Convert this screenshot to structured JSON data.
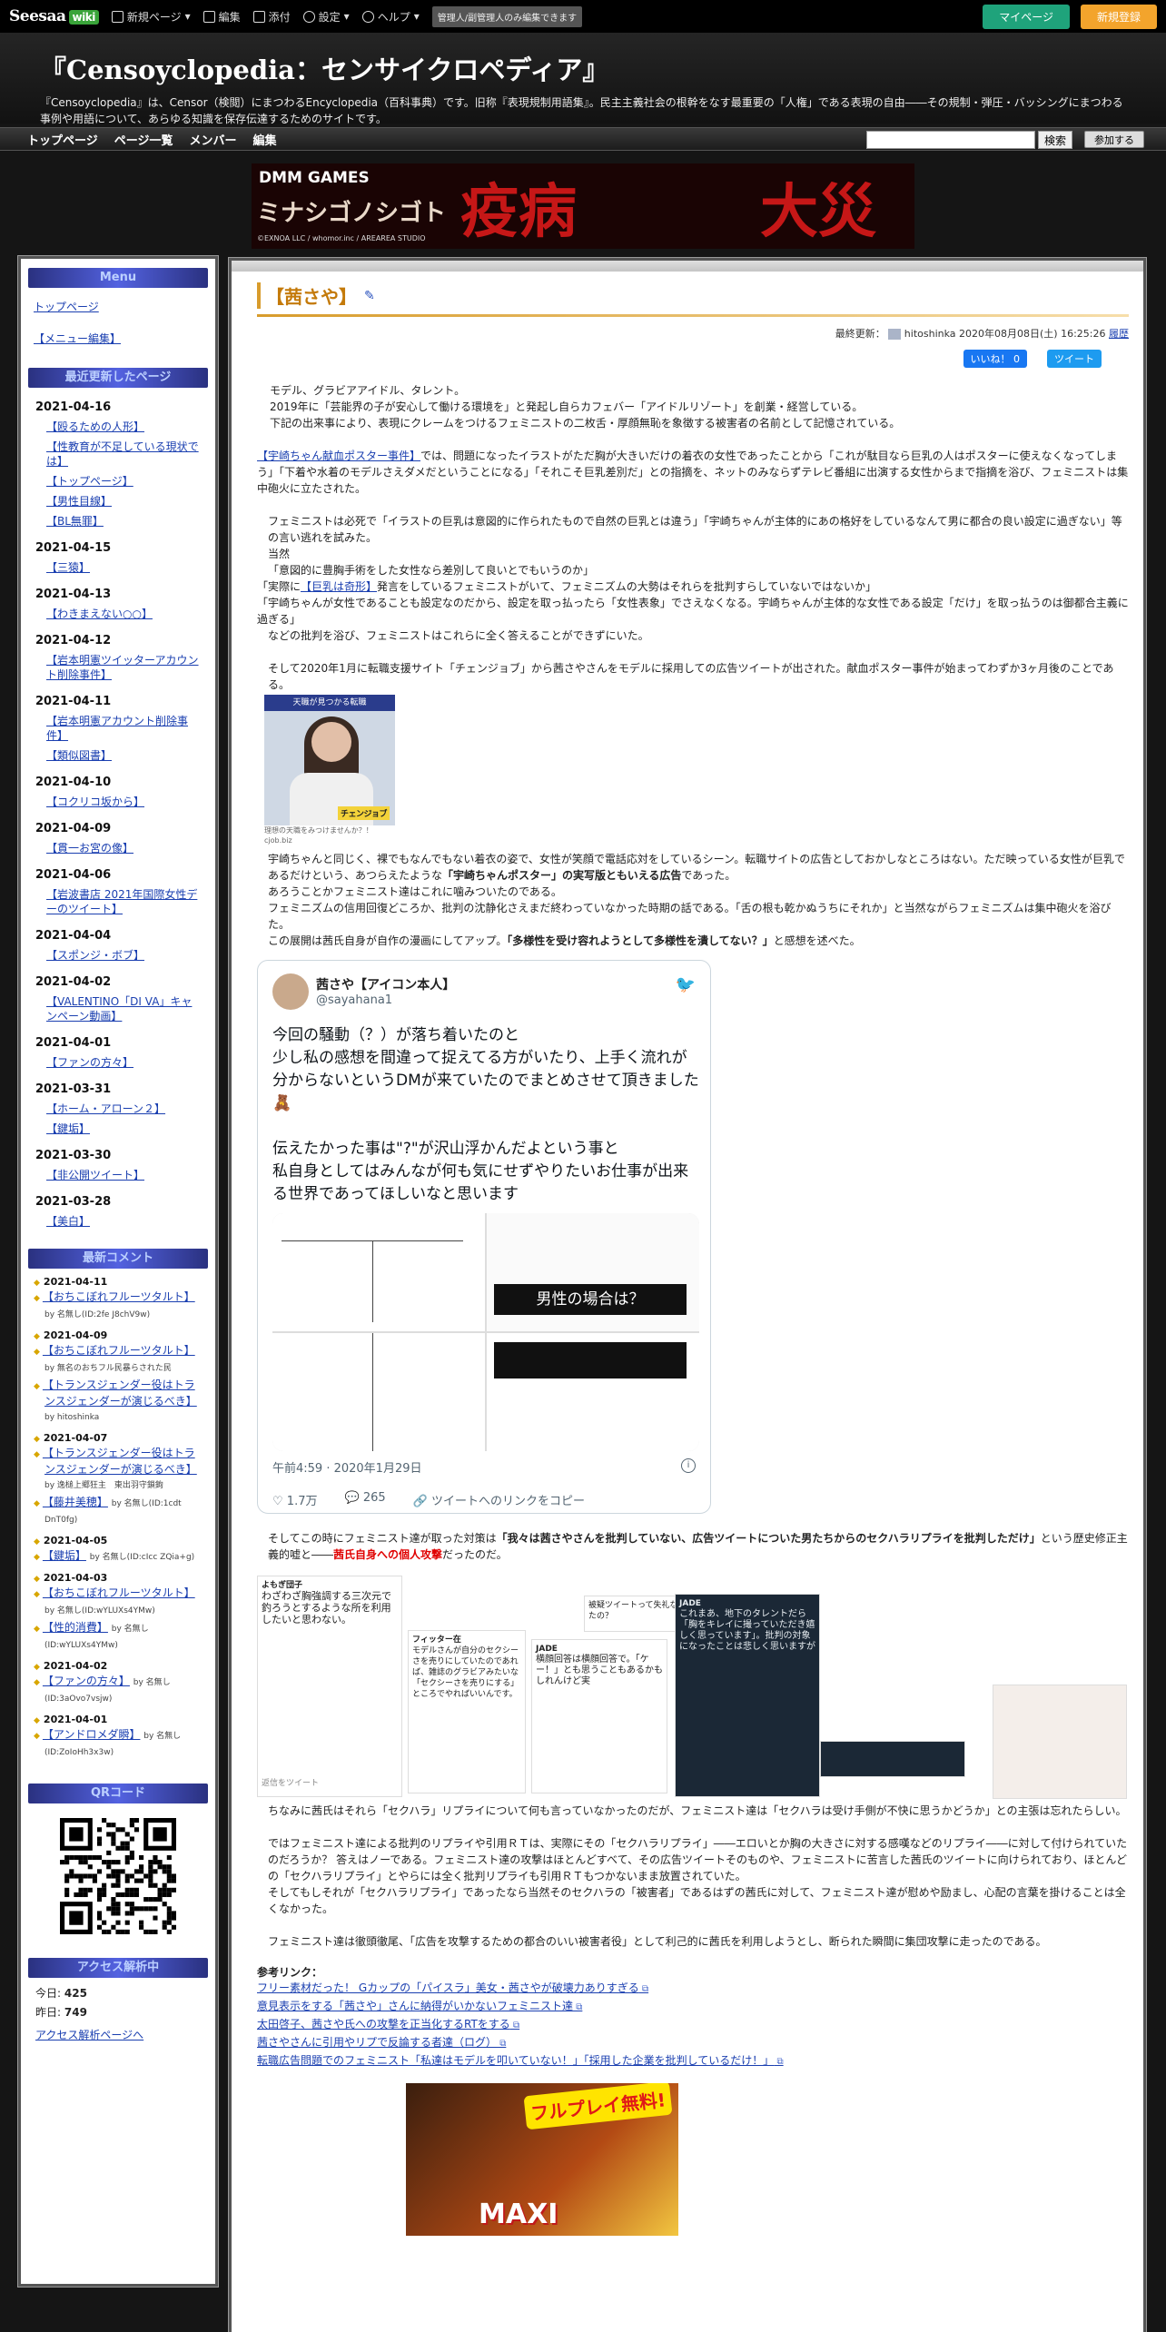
{
  "topbar": {
    "logo": "Seesaa",
    "logo_wiki": "wiki",
    "items": [
      "新規ページ",
      "編集",
      "添付",
      "設定",
      "ヘルプ"
    ],
    "admin_note": "管理人/副管理人のみ編集できます",
    "mypage": "マイページ",
    "join": "新規登録"
  },
  "header": {
    "title": "『Censoyclopedia：センサイクロペディア』",
    "desc_line1": "『Censoyclopedia』は、Censor（検閲）にまつわるEncyclopedia（百科事典）です。旧称『表現規制用語集』。民主主義社会の根幹をなす最重要の「人権」である表現の自由――その規制・弾圧・バッシングにまつわる事例や用語について、あらゆる知識を保存伝達するためのサイトです。"
  },
  "nav": {
    "items": [
      "トップページ",
      "ページ一覧",
      "メンバー",
      "編集"
    ],
    "search_button": "検索",
    "join_button": "参加する"
  },
  "banner": {
    "brand": "DMM GAMES",
    "game_title": "ミナシゴノシゴト",
    "copyright": "©EXNOA LLC / whomor.inc / AREAREA STUDIO",
    "kanji_left": "疫病",
    "kanji_right": "大災害"
  },
  "sidebar": {
    "menu_head": "Menu",
    "menu_links": [
      "トップページ",
      "【メニュー編集】"
    ],
    "recent_head": "最近更新したページ",
    "recent": [
      {
        "date": "2021-04-16",
        "items": [
          "【殴るための人形】",
          "【性教育が不足している現状では】",
          "【トップページ】",
          "【男性目線】",
          "【BL無罪】"
        ]
      },
      {
        "date": "2021-04-15",
        "items": [
          "【三猿】"
        ]
      },
      {
        "date": "2021-04-13",
        "items": [
          "【わきまえない○○】"
        ]
      },
      {
        "date": "2021-04-12",
        "items": [
          "【岩本明憲ツイッターアカウント削除事件】"
        ]
      },
      {
        "date": "2021-04-11",
        "items": [
          "【岩本明憲アカウント削除事件】",
          "【類似図書】"
        ]
      },
      {
        "date": "2021-04-10",
        "items": [
          "【コクリコ坂から】"
        ]
      },
      {
        "date": "2021-04-09",
        "items": [
          "【貫一お宮の像】"
        ]
      },
      {
        "date": "2021-04-06",
        "items": [
          "【岩波書店 2021年国際女性デーのツイート】"
        ]
      },
      {
        "date": "2021-04-04",
        "items": [
          "【スポンジ・ボブ】"
        ]
      },
      {
        "date": "2021-04-02",
        "items": [
          "【VALENTINO「DI VA」キャンペーン動画】"
        ]
      },
      {
        "date": "2021-04-01",
        "items": [
          "【ファンの方々】"
        ]
      },
      {
        "date": "2021-03-31",
        "items": [
          "【ホーム・アローン２】",
          "【鍵垢】"
        ]
      },
      {
        "date": "2021-03-30",
        "items": [
          "【非公開ツイート】"
        ]
      },
      {
        "date": "2021-03-28",
        "items": [
          "【美白】"
        ]
      }
    ],
    "comments_head": "最新コメント",
    "comments": [
      {
        "date": "2021-04-11",
        "items": [
          {
            "link": "【おちこぼれフルーツタルト】",
            "by": "by 名無し(ID:2fe J8chV9w)"
          }
        ]
      },
      {
        "date": "2021-04-09",
        "items": [
          {
            "link": "【おちこぼれフルーツタルト】",
            "by": "by 無名のおちフル民暴らされた民"
          },
          {
            "link": "【トランスジェンダー役はトランスジェンダーが演じるべき】",
            "by": "by hitoshinka"
          }
        ]
      },
      {
        "date": "2021-04-07",
        "items": [
          {
            "link": "【トランスジェンダー役はトランスジェンダーが演じるべき】",
            "by": "by 逸槌上郷狂主　東出羽守鎖鉤"
          },
          {
            "link": "【藤井美穂】",
            "by": "by 名無し(ID:1cdt DnT0fg)"
          }
        ]
      },
      {
        "date": "2021-04-05",
        "items": [
          {
            "link": "【鍵垢】",
            "by": "by 名無し(ID:cIcc ZQia+g)"
          }
        ]
      },
      {
        "date": "2021-04-03",
        "items": [
          {
            "link": "【おちこぼれフルーツタルト】",
            "by": "by 名無し(ID:wYLUXs4YMw)"
          },
          {
            "link": "【性的消費】",
            "by": "by 名無し(ID:wYLUXs4YMw)"
          }
        ]
      },
      {
        "date": "2021-04-02",
        "items": [
          {
            "link": "【ファンの方々】",
            "by": "by 名無し(ID:3aOvo7vsjw)"
          }
        ]
      },
      {
        "date": "2021-04-01",
        "items": [
          {
            "link": "【アンドロメダ瞬】",
            "by": "by 名無し(ID:ZoIoHh3x3w)"
          }
        ]
      }
    ],
    "qr_head": "QRコード",
    "access_head": "アクセス解析中",
    "today_label": "今日:",
    "today_value": "425",
    "yesterday_label": "昨日:",
    "yesterday_value": "749",
    "access_link": "アクセス解析ページへ"
  },
  "main": {
    "title": "【茜さや】",
    "updated_label": "最終更新：",
    "updated_user": "hitoshinka",
    "updated_date": "2020年08月08日(土) 16:25:26",
    "history": "履歴",
    "fb_like": "いいね！ 0",
    "tw_tweet": "ツイート",
    "intro": [
      "モデル、グラビアアイドル、タレント。",
      "2019年に「芸能界の子が安心して働ける環境を」と発起し自らカフェバー「アイドルリゾート」を創業・経営している。",
      "下記の出来事により、表現にクレームをつけるフェミニストの二枚舌・厚顔無恥を象徴する被害者の名前として記憶されている。"
    ],
    "p2_link": "【宇崎ちゃん献血ポスター事件】",
    "p2_text": "では、問題になったイラストがただ胸が大きいだけの着衣の女性であったことから「これが駄目なら巨乳の人はポスターに使えなくなってしまう」「下着や水着のモデルさえダメだということになる」「それこそ巨乳差別だ」との指摘を、ネットのみならずテレビ番組に出演する女性からまで指摘を浴び、フェミニストは集中砲火に立たされた。",
    "p3": [
      "フェミニストは必死で「イラストの巨乳は意図的に作られたもので自然の巨乳とは違う」「宇崎ちゃんが主体的にあの格好をしているなんて男に都合の良い設定に過ぎない」等の言い逃れを試みた。",
      "当然",
      "「意図的に豊胸手術をした女性なら差別して良いとでもいうのか」"
    ],
    "p3_pre": "「実際に",
    "p3_link": "【巨乳は奇形】",
    "p3_post": "発言をしているフェミニストがいて、フェミニズムの大勢はそれらを批判すらしていないではないか」",
    "p3b": [
      "「宇崎ちゃんが女性であることも設定なのだから、設定を取っ払ったら「女性表象」でさえなくなる。宇崎ちゃんが主体的な女性である設定「だけ」を取っ払うのは御都合主義に過ぎる」",
      "などの批判を浴び、フェミニストはこれらに全く答えることができずにいた。"
    ],
    "p4": "そして2020年1月に転職支援サイト「チェンジョブ」から茜さやさんをモデルに採用しての広告ツイートが出された。献血ポスター事件が始まってわずか3ヶ月後のことである。",
    "ad_bar": "天職が見つかる転職",
    "ad_logo": "チェンジョブ",
    "ad_cap1": "理想の天職をみつけませんか？！",
    "ad_cap2": "cjob.biz",
    "p5_1": "宇崎ちゃんと同じく、裸でもなんでもない着衣の姿で、女性が笑顔で電話応対をしているシーン。転職サイトの広告としておかしなところはない。ただ映っている女性が巨乳であるだけという、あつらえたような",
    "p5_1b": "「宇崎ちゃんポスター」の実写版ともいえる広告",
    "p5_1c": "であった。",
    "p5_2": "あろうことかフェミニスト達はこれに噛みついたのである。",
    "p5_3": "フェミニズムの信用回復どころか、批判の沈静化さえまだ終わっていなかった時期の話である。「舌の根も乾かぬうちにそれか」と当然ながらフェミニズムは集中砲火を浴びた。",
    "p5_4a": "この展開は茜氏自身が自作の漫画にしてアップ。",
    "p5_4b": "「多様性を受け容れようとして多様性を潰してない？」",
    "p5_4c": "と感想を述べた。",
    "tweet": {
      "name": "茜さや【アイコン本人】",
      "handle": "@sayahana1",
      "text": "今回の騒動（？）が落ち着いたのと\n少し私の感想を間違って捉えてる方がいたり、上手く流れが分からないというDMが来ていたのでまとめさせて頂きました🧸\n\n伝えたかった事は\"?\"が沢山浮かんだよという事と\n私自身としてはみんなが何も気にせずやりたいお仕事が出来る世界であってほしいなと思います",
      "manga_caption": "男性の場合は？",
      "time": "午前4:59 · 2020年1月29日",
      "likes": "1.7万",
      "replies": "265",
      "copy_link": "ツイートへのリンクをコピー"
    },
    "p6a": "そしてこの時にフェミニスト達が取った対策は",
    "p6b": "「我々は茜さやさんを批判していない、広告ツイートについた男たちからのセクハラリプライを批判しただけ」",
    "p6c": "という歴史修正主義的嘘と――",
    "p6d": "茜氏自身への個人攻撃",
    "p6e": "だったのだ。",
    "collage": {
      "c1_name": "よもぎ団子",
      "c1_text": "わざわざ胸強調する三次元で釣ろうとするような所を利用したいと思わない。",
      "c1_reply": "返信をツイート",
      "c2_name": "フィッター在",
      "c2_text": "モデルさんが自分のセクシーさを売りにしていたのであれば、雑誌のグラビアみたいな「セクシーさを売りにする」ところでやればいいんです。",
      "c3_name": "JADE",
      "c3_text": "横顔回答は横顔回答で。「ケー！」とも思うこともあるかもしれんけど実",
      "c4_title": "被疑ツイートって失礼なことを思っていたの？",
      "c5_name": "JADE",
      "c5_text": "これまあ、地下のタレントだら「胸をキレイに撮っていただき嬉しく思っています」。批判の対象になったことは悲しく思いますが"
    },
    "p7": "ちなみに茜氏はそれら「セクハラ」リプライについて何も言っていなかったのだが、フェミニスト達は「セクハラは受け手側が不快に思うかどうか」との主張は忘れたらしい。",
    "p8": [
      "ではフェミニスト達による批判のリプライや引用ＲＴは、実際にその「セクハラリプライ」――エロいとか胸の大きさに対する感嘆などのリプライ――に対して付けられていたのだろうか？ 答えはノーである。フェミニスト達の攻撃はほとんどすべて、その広告ツイートそのものや、フェミニストに苦言した茜氏のツイートに向けられており、ほとんどの「セクハラリプライ」とやらには全く批判リプライも引用ＲＴもつかないまま放置されていた。",
      "そしてもしそれが「セクハラリプライ」であったなら当然そのセクハラの「被害者」であるはずの茜氏に対して、フェミニスト達が慰めや励まし、心配の言葉を掛けることは全くなかった。"
    ],
    "p9": "フェミニスト達は徹頭徹尾、「広告を攻撃するための都合のいい被害者役」として利己的に茜氏を利用しようとし、断られた瞬間に集団攻撃に走ったのである。",
    "refs_head": "参考リンク：",
    "refs": [
      "フリー素材だった！ Gカップの「パイスラ」美女・茜さやが破壊力ありすぎる",
      "意見表示をする「茜さや」さんに納得がいかないフェミニスト達",
      "太田啓子、茜さや氏への攻撃を正当化するRTをする",
      "茜さやさんに引用やリプで反論する者達（ログ）",
      "転職広告問題でのフェミニスト「私達はモデルを叩いていない！」「採用した企業を批判しているだけ！」"
    ],
    "game_badge": "フルプレイ無料!",
    "game_text": "MAXI"
  }
}
